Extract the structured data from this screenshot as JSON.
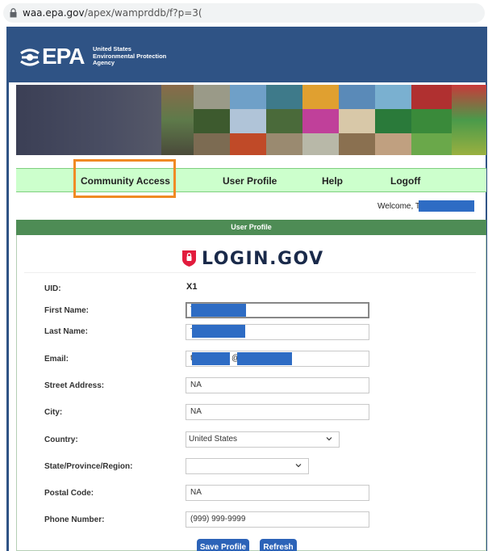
{
  "browser": {
    "url_domain": "waa.epa.gov",
    "url_path": "/apex/wamprddb/f?p=3("
  },
  "header": {
    "logo_text": "EPA",
    "agency_lines": [
      "United States",
      "Environmental Protection",
      "Agency"
    ]
  },
  "nav": {
    "items": [
      {
        "label": "Community Access",
        "highlighted": true
      },
      {
        "label": "User Profile"
      },
      {
        "label": "Help"
      },
      {
        "label": "Logoff"
      }
    ],
    "highlight_color": "#f08a24"
  },
  "welcome": {
    "text": "Welcome, T"
  },
  "panel": {
    "title": "User Profile",
    "login_brand": "LOGIN.GOV"
  },
  "form": {
    "uid": {
      "label": "UID:",
      "value": "X1"
    },
    "first_name": {
      "label": "First Name:",
      "value": "T"
    },
    "last_name": {
      "label": "Last Name:",
      "value": "T"
    },
    "email": {
      "label": "Email:",
      "value_start": "t",
      "value_mid": "@"
    },
    "street": {
      "label": "Street Address:",
      "value": "NA"
    },
    "city": {
      "label": "City:",
      "value": "NA"
    },
    "country": {
      "label": "Country:",
      "value": "United States"
    },
    "state": {
      "label": "State/Province/Region:",
      "value": ""
    },
    "postal": {
      "label": "Postal Code:",
      "value": "NA"
    },
    "phone": {
      "label": "Phone Number:",
      "value": "(999) 999-9999"
    }
  },
  "buttons": {
    "save": "Save Profile",
    "refresh": "Refresh"
  },
  "colors": {
    "header_blue": "#2f5385",
    "nav_green": "#ccffcc",
    "panel_green": "#4e8c55",
    "button_blue": "#2c63b8",
    "redaction_blue": "#2e6cc4"
  }
}
